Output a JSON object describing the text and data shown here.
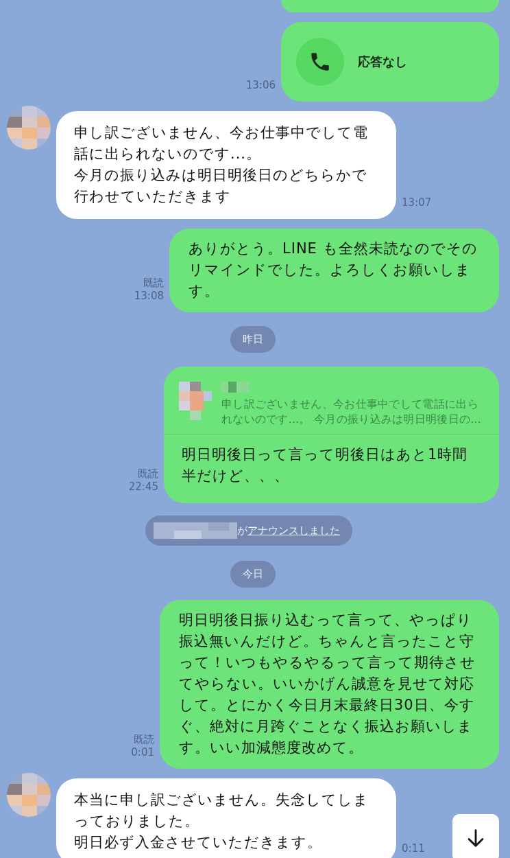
{
  "messages": [
    {
      "kind": "partial",
      "outgoing": true
    },
    {
      "kind": "call",
      "outgoing": true,
      "text": "応答なし",
      "time": "13:06"
    },
    {
      "kind": "text",
      "outgoing": false,
      "paragraphs": [
        "申し訳ございません、今お仕事中でして電話に出られないのです...。",
        "今月の振り込みは明日明後日のどちらかで行わせていただきます"
      ],
      "time": "13:07"
    },
    {
      "kind": "text",
      "outgoing": true,
      "read": "既読",
      "time": "13:08",
      "paragraphs": [
        "ありがとう。LINE も全然未読なのでそのリマインドでした。よろしくお願いします。"
      ]
    },
    {
      "kind": "date",
      "text": "昨日"
    },
    {
      "kind": "reply",
      "outgoing": true,
      "quote": "申し訳ございません、今お仕事中でして電話に出られないのです...。 今月の振り込みは明日明後日の…",
      "text": "明日明後日って言って明後日はあと1時間半だけど、、、",
      "read": "既読",
      "time": "22:45"
    },
    {
      "kind": "announce",
      "text": "が",
      "link": "アナウンスしました"
    },
    {
      "kind": "date",
      "text": "今日"
    },
    {
      "kind": "text",
      "outgoing": true,
      "read": "既読",
      "time": "0:01",
      "paragraphs": [
        "明日明後日振り込むって言って、やっぱり振込無いんだけど。ちゃんと言ったこと守って！いつもやるやるって言って期待させてやらない。いいかげん誠意を見せて対応して。とにかく今日月末最終日30日、今すぐ、絶対に月跨ぐことなく振込お願いします。いい加減態度改めて。"
      ]
    },
    {
      "kind": "text",
      "outgoing": false,
      "paragraphs": [
        "本当に申し訳ございません。失念してしまっておりました。",
        "明日必ず入金させていただきます。"
      ],
      "time": "0:11"
    }
  ]
}
